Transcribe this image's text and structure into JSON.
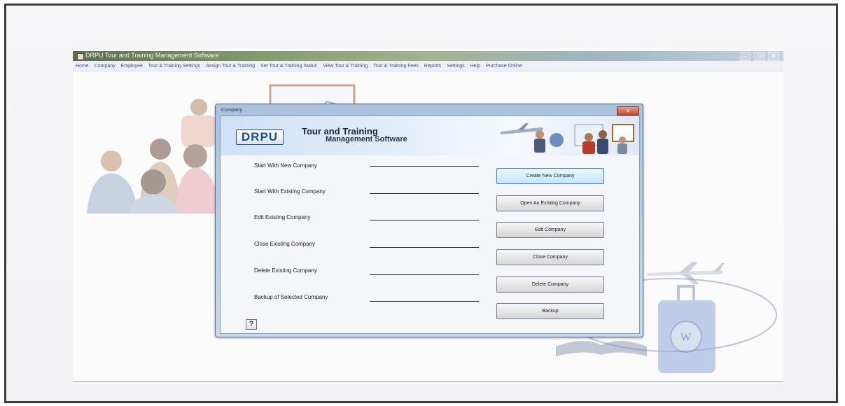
{
  "app": {
    "title": "DRPU Tour and Training Management Software",
    "window_controls": [
      "–",
      "□",
      "✕"
    ]
  },
  "menubar": {
    "items": [
      "Home",
      "Company",
      "Employee",
      "Tour & Training Settings",
      "Assign Tour & Training",
      "Set Tour & Training Status",
      "View Tour & Training",
      "Tour & Training Fees",
      "Reports",
      "Settings",
      "Help",
      "Purchase Online"
    ]
  },
  "dialog": {
    "title": "Company",
    "close_label": "✕",
    "logo": "DRPU",
    "brand_title": "Tour and Training",
    "brand_subtitle": "Management Software",
    "rows": [
      {
        "label": "Start With New Company",
        "button": "Create New Company"
      },
      {
        "label": "Start With Existing Company",
        "button": "Open An Existing Company"
      },
      {
        "label": "Edit Existing Company",
        "button": "Edit Company"
      },
      {
        "label": "Close Existing Company",
        "button": "Close Company"
      },
      {
        "label": "Delete Existing Company",
        "button": "Delete Company"
      },
      {
        "label": "Backup of Selected Company",
        "button": "Backup"
      }
    ],
    "help_label": "?"
  },
  "colors": {
    "menu_text": "#3a4a9a",
    "logo_blue": "#1e4c90",
    "close_red": "#c9452f",
    "focused_button": "#bee6fd"
  }
}
